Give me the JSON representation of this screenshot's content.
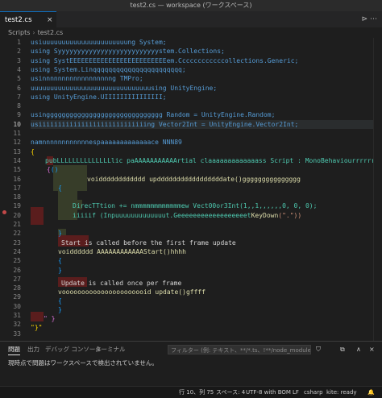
{
  "window": {
    "title": "test2.cs — workspace (ワークスペース)"
  },
  "tab": {
    "label": "test2.cs",
    "close": "×",
    "actions": "⊳  ⋯"
  },
  "breadcrumbs": [
    "Scripts",
    "test2.cs"
  ],
  "editor": {
    "line_numbers": [
      "1",
      "2",
      "3",
      "4",
      "5",
      "6",
      "7",
      "8",
      "9",
      "10",
      "11",
      "12",
      "13",
      "14",
      "15",
      "16",
      "17",
      "18",
      "19",
      "20",
      "21",
      "22",
      "23",
      "24",
      "25",
      "26",
      "27",
      "28",
      "29",
      "30",
      "31",
      "32",
      "33"
    ],
    "active_line": "10",
    "lines": {
      "l1": [
        "usiuuuuuuuuuuuuuuuuuuuuuung System;"
      ],
      "l2": [
        "using Syyyyyyyyyyyyyyyyyyyyyyyyyystem.Collections;"
      ],
      "l3": [
        "using SystEEEEEEEEEEEEEEEEEEEEEEEEEem.Ccccccccccccollections.Generic;"
      ],
      "l4": [
        "using System.Linqqqqqqqqqqqqqqqqqqqqqqq;"
      ],
      "l5": [
        "usinnnnnnnnnnnnnnnnnng TMPro;"
      ],
      "l6": [
        "uuuuuuuuuuuuuuuuuuuuuuuuuuuuuuusing UnityEngine;"
      ],
      "l7": [
        "using UnityEngine.UIIIIIIIIIIIIIII;"
      ],
      "l9": [
        "usingggggggggggggggggggggggggggggg Random = UnityEngine.Random;"
      ],
      "l10": [
        "usiiiiiiiiiiiiiiiiiiiiiiiiiiiing Vector2Int = UnityEngine.Vector2Int;"
      ],
      "l12": [
        "namnnnnnnnnnnnnespaaaaaaaaaaaaace NNN89"
      ],
      "l13": [
        "{"
      ],
      "l14": [
        "pubLLLLLLLLLLLLLLlic paAAAAAAAAAAArtial claaaaaaaaaaaaass Script : MonoBehaviourrrrrrrrrrrrr"
      ],
      "l15": [
        "{",
        "{",
        "()"
      ],
      "l16": [
        "voidddddddddddd updddddddddddddddddate()ggggggggggggggg"
      ],
      "l17": [
        "{"
      ],
      "l19": [
        "DirecTTtion += nmmmmmmmmmmmmew Vect00or3Int(1,,1,,,,,,0, 0, 0);"
      ],
      "l20": [
        "iiiiif (Inpuuuuuuuuuuuuut.Geeeeeeeeeeeeeeeeeet",
        "KeyDown",
        "(\".\"))"
      ],
      "l23": [
        "}"
      ],
      "l24": [
        "Start is called before the first frame update"
      ],
      "l25": [
        "voidddddd AAAAAAAAAAAAStart()hhhh"
      ],
      "l26": [
        "{"
      ],
      "l27": [
        "}"
      ],
      "l29": [
        "Update is called once per frame"
      ],
      "l30": [
        "voooooooooooooooooooooid update()gffff"
      ],
      "l31": [
        "{"
      ],
      "l32": [
        "}"
      ],
      "l33": [
        "\" }"
      ],
      "l34": [
        "\"}\""
      ]
    }
  },
  "panel": {
    "tabs": [
      "問題",
      "出力",
      "デバッグ コンソール",
      "ターミナル"
    ],
    "filter_placeholder": "フィルター (例: テキスト、**/*.ts、!**/node_modules/**)",
    "message": "現時点で問題はワークスペースで検出されていません。",
    "icons": {
      "filter": "⛉",
      "copy": "⧉",
      "more": "∧",
      "close": "×"
    }
  },
  "statusbar": {
    "position": "行 10、列 75",
    "spaces": "スペース: 4",
    "encoding": "UTF-8 with BOM",
    "eol": "LF",
    "language": "csharp",
    "kite": "kite: ready",
    "bell": "🔔"
  },
  "colors": {
    "accent": "#0e70c0",
    "keyword": "#569cd6",
    "type": "#4ec9b0",
    "string": "#ce9178",
    "number": "#b5cea8",
    "error_bg": "#5a1d1d"
  }
}
